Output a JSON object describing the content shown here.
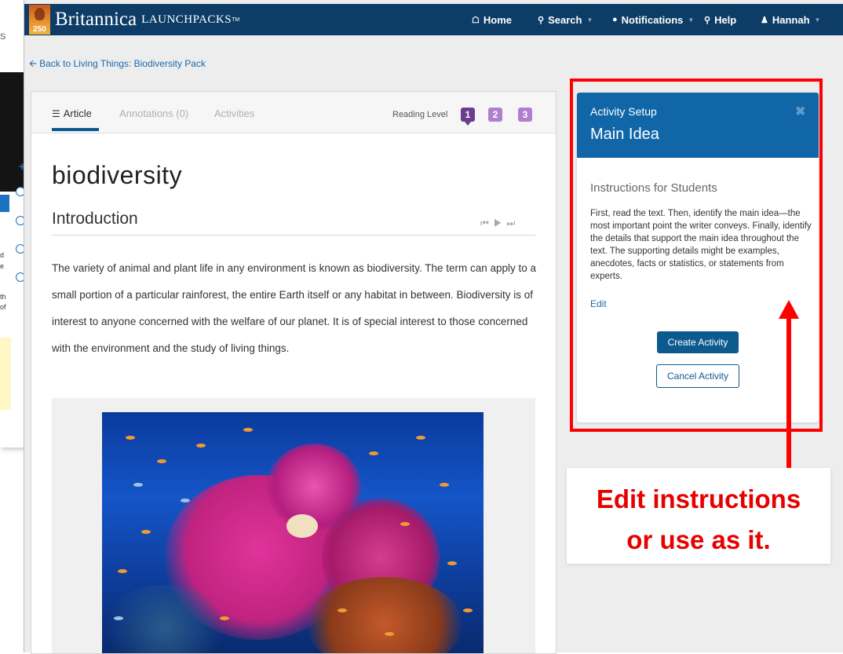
{
  "underlying_window": {
    "fragments": [
      "S",
      "d",
      "e",
      "th",
      "of"
    ]
  },
  "nav": {
    "logo_badge": "250",
    "logo_brand": "Britannica",
    "logo_product": "LAUNCHPACKS",
    "logo_tm": "TM",
    "items": [
      {
        "label": "Home",
        "icon": "home-icon"
      },
      {
        "label": "Search",
        "icon": "search-icon"
      },
      {
        "label": "Notifications",
        "icon": "speech-bubble-icon"
      },
      {
        "label": "Help",
        "icon": "lightbulb-icon"
      },
      {
        "label": "Hannah",
        "icon": "user-icon"
      }
    ]
  },
  "back_link": "Back to Living Things: Biodiversity Pack",
  "article": {
    "tabs": [
      {
        "label": "Article",
        "active": true
      },
      {
        "label": "Annotations (0)",
        "active": false
      },
      {
        "label": "Activities",
        "active": false
      }
    ],
    "reading_level_label": "Reading Level",
    "reading_levels": [
      "1",
      "2",
      "3"
    ],
    "title": "biodiversity",
    "section": "Introduction",
    "body": "The variety of animal and plant life in any environment is known as biodiversity. The term can apply to a small portion of a particular rainforest, the entire Earth itself or any habitat in between. Biodiversity is of interest to anyone concerned with the welfare of our planet. It is of special interest to those concerned with the environment and the study of living things."
  },
  "activity_setup": {
    "kicker": "Activity Setup",
    "title": "Main Idea",
    "instructions_heading": "Instructions for Students",
    "instructions": "First, read the text. Then, identify the main idea—the most important point the writer conveys. Finally, identify the details that support the main idea throughout the text. The supporting details might be examples, anecdotes, facts or statistics, or statements from experts.",
    "edit_label": "Edit",
    "create_label": "Create Activity",
    "cancel_label": "Cancel Activity"
  },
  "annotation": {
    "line1": "Edit instructions",
    "line2": "or use as it.",
    "color": "#e60000"
  },
  "colors": {
    "navbar": "#0d3d66",
    "panel_header": "#1166a8",
    "primary_button": "#0d5a8f",
    "reading_level_active": "#6a3d8f",
    "reading_level_inactive": "#b07fcf"
  }
}
